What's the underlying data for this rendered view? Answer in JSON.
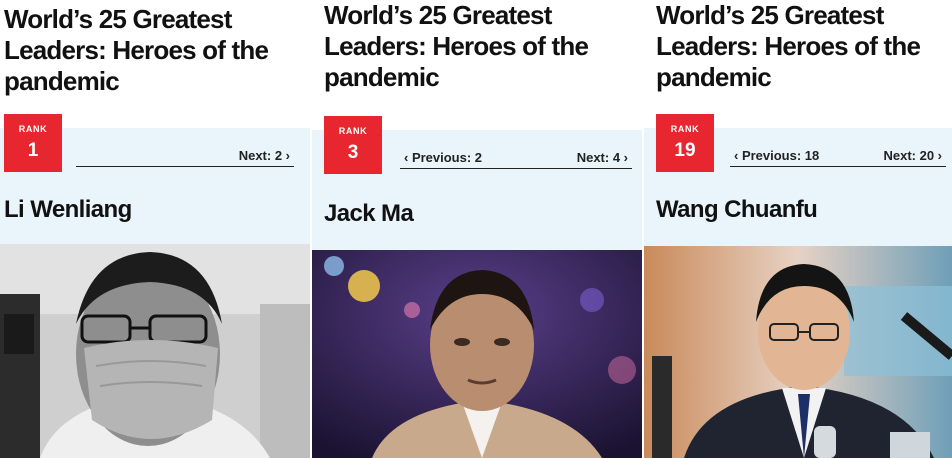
{
  "panels": [
    {
      "title": "World’s 25 Greatest Leaders: Heroes of the pandemic",
      "rank_label": "RANK",
      "rank": "1",
      "previous": "",
      "next": "Next: 2 ›",
      "name": "Li Wenliang",
      "photo_icon": "portrait-photo-bw-masked"
    },
    {
      "title": "World’s 25 Greatest Leaders: Heroes of the pandemic",
      "rank_label": "RANK",
      "rank": "3",
      "previous": "‹ Previous: 2",
      "next": "Next: 4 ›",
      "name": "Jack Ma",
      "photo_icon": "portrait-photo-stage"
    },
    {
      "title": "World’s 25 Greatest Leaders: Heroes of the pandemic",
      "rank_label": "RANK",
      "rank": "19",
      "previous": "‹ Previous: 18",
      "next": "Next: 20 ›",
      "name": "Wang Chuanfu",
      "photo_icon": "portrait-photo-press"
    }
  ],
  "colors": {
    "rank_red": "#e8262f",
    "band": "#eaf4fb",
    "text": "#111111"
  }
}
